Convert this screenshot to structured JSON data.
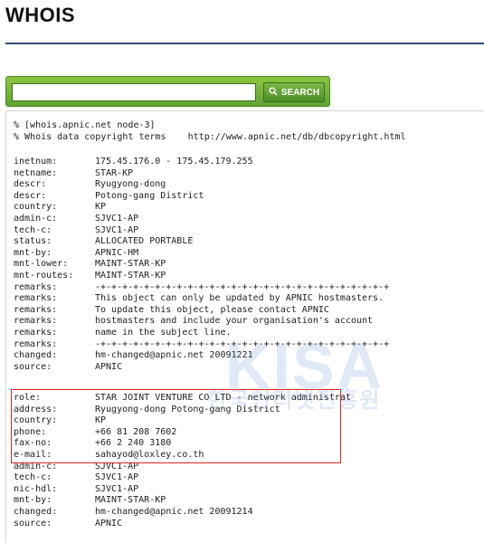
{
  "page": {
    "title": "WHOIS"
  },
  "search": {
    "placeholder": "",
    "value": "",
    "button_label": "SEARCH",
    "accent_color": "#6bb33a"
  },
  "watermark": {
    "logo": "KISA",
    "subtitle": "한국인터넷진흥원"
  },
  "header_lines": [
    "% [whois.apnic.net node-3]",
    "% Whois data copyright terms    http://www.apnic.net/db/dbcopyright.html"
  ],
  "inetnum_block": [
    {
      "key": "inetnum:",
      "value": "175.45.176.0 - 175.45.179.255"
    },
    {
      "key": "netname:",
      "value": "STAR-KP"
    },
    {
      "key": "descr:",
      "value": "Ryugyong-dong"
    },
    {
      "key": "descr:",
      "value": "Potong-gang District"
    },
    {
      "key": "country:",
      "value": "KP"
    },
    {
      "key": "admin-c:",
      "value": "SJVC1-AP"
    },
    {
      "key": "tech-c:",
      "value": "SJVC1-AP"
    },
    {
      "key": "status:",
      "value": "ALLOCATED PORTABLE"
    },
    {
      "key": "mnt-by:",
      "value": "APNIC-HM"
    },
    {
      "key": "mnt-lower:",
      "value": "MAINT-STAR-KP"
    },
    {
      "key": "mnt-routes:",
      "value": "MAINT-STAR-KP"
    },
    {
      "key": "remarks:",
      "value": "-+-+-+-+-+-+-+-+-+-+-+-+-+-+-+-+-+-+-+-+-+-+-+-+-+-+-+"
    },
    {
      "key": "remarks:",
      "value": "This object can only be updated by APNIC hostmasters."
    },
    {
      "key": "remarks:",
      "value": "To update this object, please contact APNIC"
    },
    {
      "key": "remarks:",
      "value": "hostmasters and include your organisation's account"
    },
    {
      "key": "remarks:",
      "value": "name in the subject line."
    },
    {
      "key": "remarks:",
      "value": "-+-+-+-+-+-+-+-+-+-+-+-+-+-+-+-+-+-+-+-+-+-+-+-+-+-+-+"
    },
    {
      "key": "changed:",
      "value": "hm-changed@apnic.net 20091221"
    },
    {
      "key": "source:",
      "value": "APNIC"
    }
  ],
  "role_block": [
    {
      "key": "role:",
      "value": "STAR JOINT VENTURE CO LTD - network administrat"
    },
    {
      "key": "address:",
      "value": "Ryugyong-dong Potong-gang District"
    },
    {
      "key": "country:",
      "value": "KP"
    },
    {
      "key": "phone:",
      "value": "+66 81 208 7602"
    },
    {
      "key": "fax-no:",
      "value": "+66 2 240 3180"
    },
    {
      "key": "e-mail:",
      "value": "sahayod@loxley.co.th"
    },
    {
      "key": "admin-c:",
      "value": "SJVC1-AP"
    },
    {
      "key": "tech-c:",
      "value": "SJVC1-AP"
    },
    {
      "key": "nic-hdl:",
      "value": "SJVC1-AP"
    },
    {
      "key": "mnt-by:",
      "value": "MAINT-STAR-KP"
    },
    {
      "key": "changed:",
      "value": "hm-changed@apnic.net 20091214"
    },
    {
      "key": "source:",
      "value": "APNIC"
    }
  ]
}
